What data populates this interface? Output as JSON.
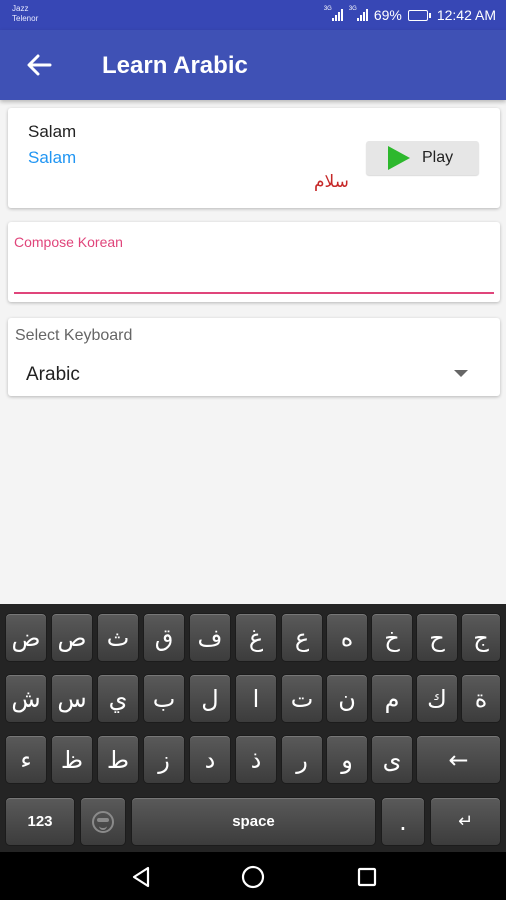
{
  "status_bar": {
    "carrier1": "Jazz",
    "carrier2": "Telenor",
    "sig1_tag": "3G",
    "sig2_tag": "3G",
    "battery": "69%",
    "battery_level": 0.69,
    "time": "12:42 AM"
  },
  "app_bar": {
    "back_icon": "arrow-back-icon",
    "title": "Learn Arabic"
  },
  "word_card": {
    "english": "Salam",
    "transliteration": "Salam",
    "arabic": "سلام",
    "play_label": "Play",
    "play_icon": "play-triangle-icon",
    "play_color": "#2db82d"
  },
  "compose": {
    "label": "Compose Korean",
    "value": "",
    "accent": "#e0457b"
  },
  "keyboard_select": {
    "label": "Select Keyboard",
    "value": "Arabic"
  },
  "keyboard": {
    "row1": [
      "ض",
      "ص",
      "ث",
      "ق",
      "ف",
      "غ",
      "ع",
      "ه",
      "خ",
      "ح",
      "ج"
    ],
    "row2": [
      "ش",
      "س",
      "ي",
      "ب",
      "ل",
      "ا",
      "ت",
      "ن",
      "م",
      "ك",
      "ة"
    ],
    "row3": [
      "ء",
      "ظ",
      "ط",
      "ز",
      "د",
      "ذ",
      "ر",
      "و",
      "ى"
    ],
    "backspace": "←",
    "numbers": "123",
    "emoji_icon": "emoji-icon",
    "space": "space",
    "period": ".",
    "enter": "↵"
  },
  "nav_bar": {
    "back_icon": "triangle-back-icon",
    "home_icon": "circle-home-icon",
    "recent_icon": "square-recent-icon"
  }
}
